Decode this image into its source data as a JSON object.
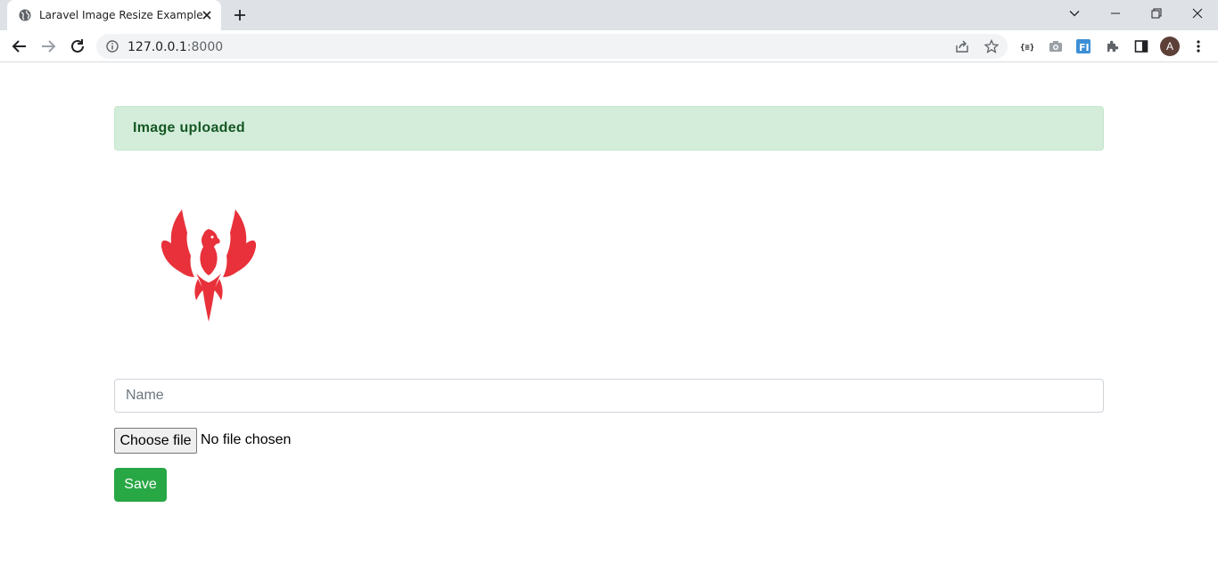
{
  "browser": {
    "tab_title": "Laravel Image Resize Example",
    "url_host": "127.0.0.1",
    "url_port": ":8000",
    "avatar_initial": "A"
  },
  "page": {
    "alert_message": "Image uploaded",
    "name_placeholder": "Name",
    "file_button_label": "Choose file",
    "file_status": "No file chosen",
    "save_label": "Save"
  },
  "colors": {
    "alert_bg": "#d4edda",
    "alert_text": "#155724",
    "save_bg": "#28a745",
    "logo_red": "#e8313a"
  },
  "icons": [
    "globe-icon",
    "close-icon",
    "plus-icon",
    "chevron-down-icon",
    "minimize-icon",
    "restore-icon",
    "close-window-icon",
    "back-arrow-icon",
    "forward-arrow-icon",
    "reload-icon",
    "info-icon",
    "share-icon",
    "star-icon",
    "json-extension-icon",
    "camera-extension-icon",
    "fi-extension-icon",
    "puzzle-icon",
    "side-panel-icon",
    "kebab-menu-icon",
    "phoenix-logo"
  ]
}
